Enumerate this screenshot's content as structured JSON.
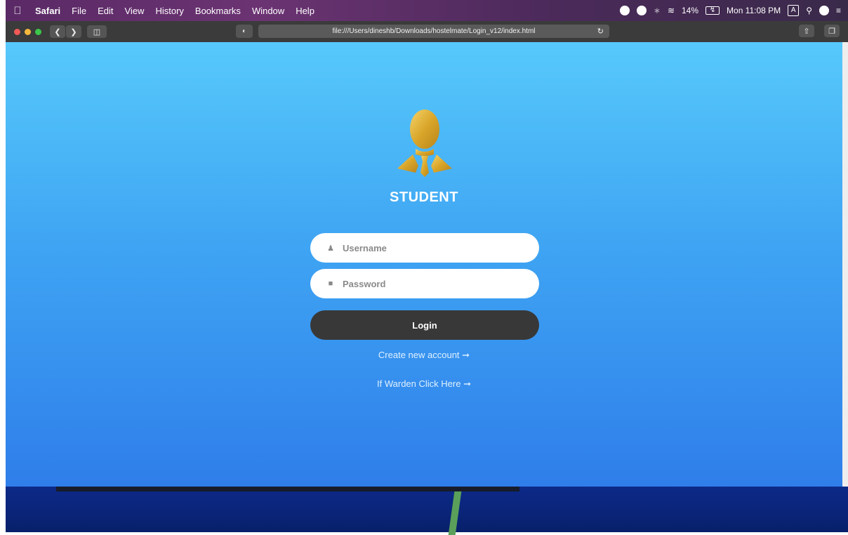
{
  "menubar": {
    "app": "Safari",
    "items": [
      "File",
      "Edit",
      "View",
      "History",
      "Bookmarks",
      "Window",
      "Help"
    ],
    "battery": "14%",
    "clock": "Mon 11:08 PM",
    "input_source": "A"
  },
  "toolbar": {
    "url": "file:///Users/dineshb/Downloads/hostelmate/Login_v12/index.html"
  },
  "page": {
    "title": "STUDENT",
    "username_placeholder": "Username",
    "password_placeholder": "Password",
    "login_label": "Login",
    "create_account": "Create new account ➞",
    "warden_link": "If Warden Click Here ➞"
  },
  "colors": {
    "gradient_top": "#57c9fb",
    "gradient_bottom": "#2f7eea",
    "login_button": "#383838"
  }
}
